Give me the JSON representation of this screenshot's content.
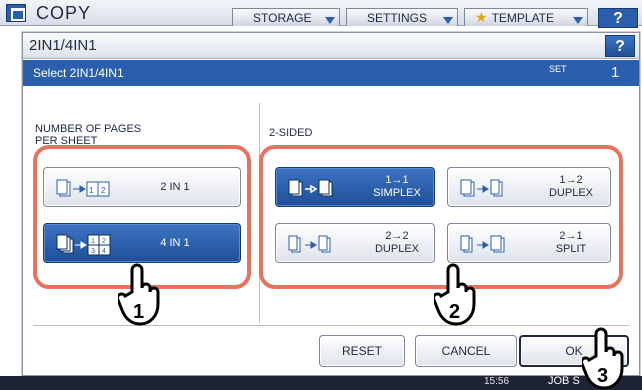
{
  "app": {
    "title": "COPY",
    "tabs": [
      {
        "label": "STORAGE"
      },
      {
        "label": "SETTINGS"
      },
      {
        "label": "TEMPLATE"
      }
    ],
    "help": "?"
  },
  "dialog": {
    "title": "2IN1/4IN1",
    "help": "?",
    "instruction": "Select 2IN1/4IN1",
    "set_label": "SET",
    "set_value": "1"
  },
  "pages_per_sheet": {
    "label": "NUMBER OF PAGES\nPER SHEET",
    "options": [
      {
        "label": "2 IN 1",
        "selected": false,
        "icon": "two-in-one-icon"
      },
      {
        "label": "4 IN 1",
        "selected": true,
        "icon": "four-in-one-icon"
      }
    ]
  },
  "two_sided": {
    "label": "2-SIDED",
    "options": [
      {
        "line1": "1→1",
        "line2": "SIMPLEX",
        "selected": true,
        "icon": "simplex-icon"
      },
      {
        "line1": "1→2",
        "line2": "DUPLEX",
        "selected": false,
        "icon": "one-to-two-duplex-icon"
      },
      {
        "line1": "2→2",
        "line2": "DUPLEX",
        "selected": false,
        "icon": "two-to-two-duplex-icon"
      },
      {
        "line1": "2→1",
        "line2": "SPLIT",
        "selected": false,
        "icon": "split-icon"
      }
    ]
  },
  "actions": {
    "reset": "RESET",
    "cancel": "CANCEL",
    "ok": "OK"
  },
  "status": {
    "time": "15:56",
    "job": "JOB S"
  },
  "callouts": [
    "1",
    "2",
    "3"
  ],
  "colors": {
    "accent": "#2b5fae",
    "highlight": "#e8735d"
  }
}
